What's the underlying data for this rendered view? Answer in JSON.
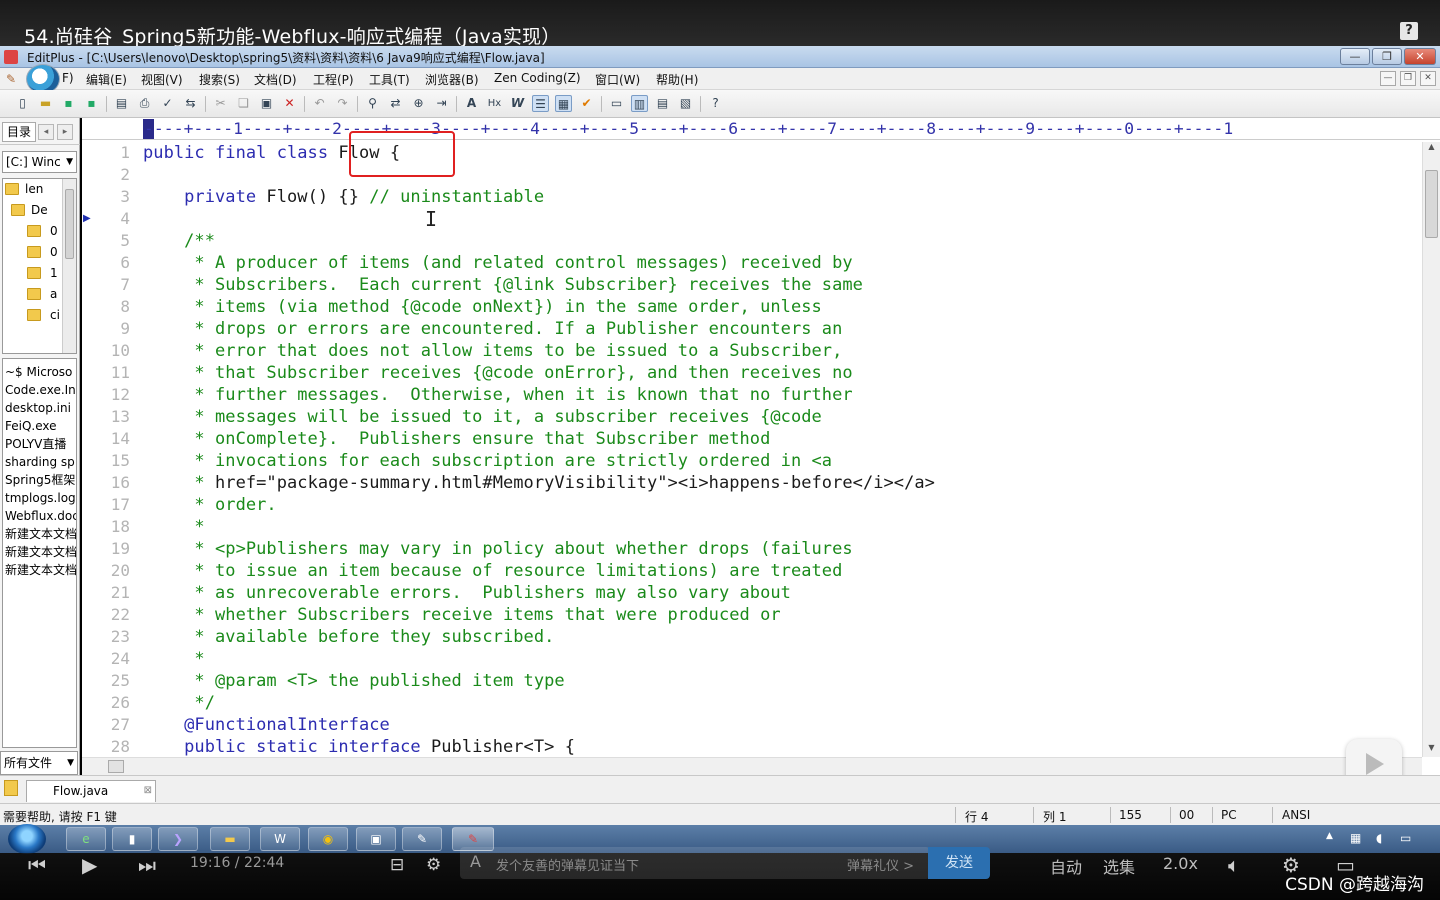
{
  "video": {
    "title": "54.尚硅谷_Spring5新功能-Webflux-响应式编程（Java实现）",
    "help_label": "?"
  },
  "app": {
    "title": "EditPlus - [C:\\Users\\lenovo\\Desktop\\spring5\\资料\\资料\\资料\\6 Java9响应式编程\\Flow.java]",
    "min_label": "—",
    "max_label": "❐",
    "close_label": "✕"
  },
  "menu": {
    "items": [
      "F)",
      "编辑(E)",
      "视图(V)",
      "搜索(S)",
      "文档(D)",
      "工程(P)",
      "工具(T)",
      "浏览器(B)",
      "Zen Coding(Z)",
      "窗口(W)",
      "帮助(H)"
    ]
  },
  "sidebar": {
    "tab_label": "目录",
    "drive_label": "[C:] Winc",
    "tree": [
      {
        "label": "len",
        "indent": 1
      },
      {
        "label": "De",
        "indent": 2
      },
      {
        "label": "0",
        "indent": 3
      },
      {
        "label": "0",
        "indent": 3
      },
      {
        "label": "1",
        "indent": 3
      },
      {
        "label": "a",
        "indent": 3
      },
      {
        "label": "ci",
        "indent": 3
      }
    ],
    "files": [
      "~$ Microso",
      "Code.exe.In",
      "desktop.ini",
      "FeiQ.exe",
      "POLYV直播",
      "sharding sp",
      "Spring5框架",
      "tmplogs.log",
      "Webflux.doc",
      "新建文本文档",
      "新建文本文档",
      "新建文本文档"
    ],
    "filter_label": "所有文件"
  },
  "editor": {
    "ruler": "----+----1----+----2----+----3----+----4----+----5----+----6----+----7----+----8----+----9----+----0----+----1",
    "lines": [
      {
        "n": "1",
        "parts": [
          {
            "c": "kw",
            "t": "public final class "
          },
          {
            "c": "",
            "t": "Flow {"
          }
        ]
      },
      {
        "n": "2",
        "parts": []
      },
      {
        "n": "3",
        "parts": [
          {
            "c": "",
            "t": "    "
          },
          {
            "c": "kw",
            "t": "private"
          },
          {
            "c": "",
            "t": " Flow() {} "
          },
          {
            "c": "cm",
            "t": "// uninstantiable"
          }
        ]
      },
      {
        "n": "4",
        "parts": []
      },
      {
        "n": "5",
        "parts": [
          {
            "c": "cm",
            "t": "    /**"
          }
        ]
      },
      {
        "n": "6",
        "parts": [
          {
            "c": "cm",
            "t": "     * A producer of items (and related control messages) received by"
          }
        ]
      },
      {
        "n": "7",
        "parts": [
          {
            "c": "cm",
            "t": "     * Subscribers.  Each current {@link Subscriber} receives the same"
          }
        ]
      },
      {
        "n": "8",
        "parts": [
          {
            "c": "cm",
            "t": "     * items (via method {@code onNext}) in the same order, unless"
          }
        ]
      },
      {
        "n": "9",
        "parts": [
          {
            "c": "cm",
            "t": "     * drops or errors are encountered. If a Publisher encounters an"
          }
        ]
      },
      {
        "n": "10",
        "parts": [
          {
            "c": "cm",
            "t": "     * error that does not allow items to be issued to a Subscriber,"
          }
        ]
      },
      {
        "n": "11",
        "parts": [
          {
            "c": "cm",
            "t": "     * that Subscriber receives {@code onError}, and then receives no"
          }
        ]
      },
      {
        "n": "12",
        "parts": [
          {
            "c": "cm",
            "t": "     * further messages.  Otherwise, when it is known that no further"
          }
        ]
      },
      {
        "n": "13",
        "parts": [
          {
            "c": "cm",
            "t": "     * messages will be issued to it, a subscriber receives {@code"
          }
        ]
      },
      {
        "n": "14",
        "parts": [
          {
            "c": "cm",
            "t": "     * onComplete}.  Publishers ensure that Subscriber method"
          }
        ]
      },
      {
        "n": "15",
        "parts": [
          {
            "c": "cm",
            "t": "     * invocations for each subscription are strictly ordered in <a"
          }
        ]
      },
      {
        "n": "16",
        "parts": [
          {
            "c": "cm",
            "t": "     * "
          },
          {
            "c": "",
            "t": "href=\"package-summary.html#MemoryVisibility\"><i>happens-before</i></a>"
          }
        ]
      },
      {
        "n": "17",
        "parts": [
          {
            "c": "cm",
            "t": "     * order."
          }
        ]
      },
      {
        "n": "18",
        "parts": [
          {
            "c": "cm",
            "t": "     *"
          }
        ]
      },
      {
        "n": "19",
        "parts": [
          {
            "c": "cm",
            "t": "     * <p>Publishers may vary in policy about whether drops (failures"
          }
        ]
      },
      {
        "n": "20",
        "parts": [
          {
            "c": "cm",
            "t": "     * to issue an item because of resource limitations) are treated"
          }
        ]
      },
      {
        "n": "21",
        "parts": [
          {
            "c": "cm",
            "t": "     * as unrecoverable errors.  Publishers may also vary about"
          }
        ]
      },
      {
        "n": "22",
        "parts": [
          {
            "c": "cm",
            "t": "     * whether Subscribers receive items that were produced or"
          }
        ]
      },
      {
        "n": "23",
        "parts": [
          {
            "c": "cm",
            "t": "     * available before they subscribed."
          }
        ]
      },
      {
        "n": "24",
        "parts": [
          {
            "c": "cm",
            "t": "     *"
          }
        ]
      },
      {
        "n": "25",
        "parts": [
          {
            "c": "cm",
            "t": "     * @param <T> the published item type"
          }
        ]
      },
      {
        "n": "26",
        "parts": [
          {
            "c": "cm",
            "t": "     */"
          }
        ]
      },
      {
        "n": "27",
        "parts": [
          {
            "c": "",
            "t": "    "
          },
          {
            "c": "an",
            "t": "@FunctionalInterface"
          }
        ]
      },
      {
        "n": "28",
        "parts": [
          {
            "c": "",
            "t": "    "
          },
          {
            "c": "kw",
            "t": "public static interface"
          },
          {
            "c": "",
            "t": " Publisher<T> {"
          }
        ]
      }
    ]
  },
  "doctab": {
    "name": "Flow.java",
    "close": "⊠"
  },
  "status": {
    "help": "需要帮助, 请按 F1 键",
    "line": "行 4",
    "col": "列 1",
    "count": "155",
    "code": "00",
    "eol": "PC",
    "encoding": "ANSI"
  },
  "player": {
    "time": "19:16 / 22:44",
    "danmaku_placeholder": "发个友善的弹幕见证当下",
    "gift_label": "弹幕礼仪 >",
    "send_label": "发送",
    "auto_label": "自动",
    "episodes_label": "选集",
    "speed_label": "2.0x",
    "watermark": "CSDN @跨越海沟"
  }
}
